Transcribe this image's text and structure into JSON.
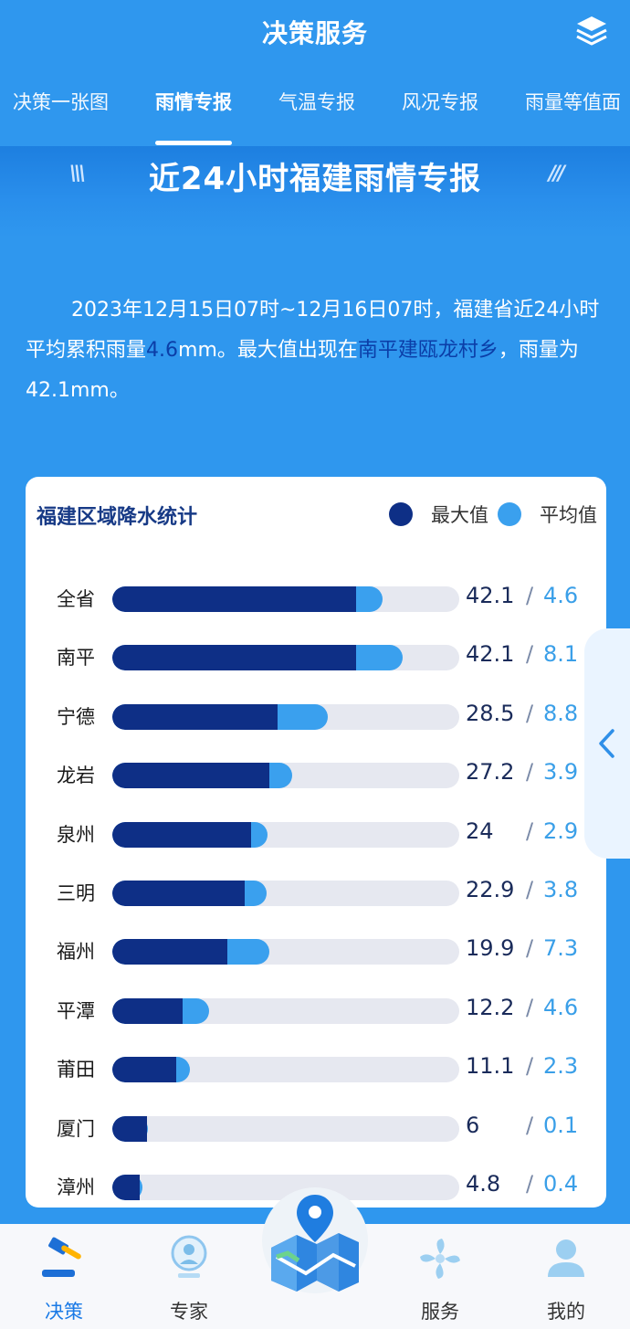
{
  "header": {
    "title": "决策服务",
    "layers_icon": "layers-icon"
  },
  "tabs": [
    {
      "label": "决策一张图",
      "active": false
    },
    {
      "label": "雨情专报",
      "active": true
    },
    {
      "label": "气温专报",
      "active": false
    },
    {
      "label": "风况专报",
      "active": false
    },
    {
      "label": "雨量等值面",
      "active": false
    }
  ],
  "banner": {
    "title": "近24小时福建雨情专报",
    "left_deco": "\\\\\\",
    "right_deco": "///"
  },
  "summary": {
    "part1": "2023年12月15日07时~12月16日07时，福建省近24小时平均累积雨量",
    "avg_value": "4.6",
    "part2": "mm。最大值出现在",
    "max_location": "南平建瓯龙村乡",
    "part3": "，雨量为",
    "max_value": "42.1",
    "part4": "mm。"
  },
  "card": {
    "title": "福建区域降水统计",
    "legend": {
      "max_label": "最大值",
      "avg_label": "平均值"
    },
    "colors": {
      "max": "#0e2f86",
      "avg": "#3aa0ee",
      "track": "#e6e8f0"
    }
  },
  "chart_data": {
    "type": "bar",
    "title": "福建区域降水统计",
    "categories": [
      "全省",
      "南平",
      "宁德",
      "龙岩",
      "泉州",
      "三明",
      "福州",
      "平潭",
      "莆田",
      "厦门",
      "漳州"
    ],
    "series": [
      {
        "name": "最大值",
        "values": [
          42.1,
          42.1,
          28.5,
          27.2,
          24,
          22.9,
          19.9,
          12.2,
          11.1,
          6,
          4.8
        ]
      },
      {
        "name": "平均值",
        "values": [
          4.6,
          8.1,
          8.8,
          3.9,
          2.9,
          3.8,
          7.3,
          4.6,
          2.3,
          0.1,
          0.4
        ]
      }
    ],
    "display_max": [
      "42.1",
      "42.1",
      "28.5",
      "27.2",
      "24",
      "22.9",
      "19.9",
      "12.2",
      "11.1",
      "6",
      "4.8"
    ],
    "display_avg": [
      "4.6",
      "8.1",
      "8.8",
      "3.9",
      "2.9",
      "3.8",
      "7.3",
      "4.6",
      "2.3",
      "0.1",
      "0.4"
    ],
    "separator": "/",
    "xlim": [
      0,
      60
    ],
    "stacked": true
  },
  "side_handle": {
    "icon": "chevron-left-icon"
  },
  "bottom_nav": [
    {
      "label": "决策",
      "icon": "gavel-icon",
      "active": true
    },
    {
      "label": "专家",
      "icon": "expert-icon",
      "active": false
    },
    {
      "label": "服务",
      "icon": "fan-icon",
      "active": false
    },
    {
      "label": "我的",
      "icon": "user-icon",
      "active": false
    }
  ],
  "center_button": {
    "icon": "map-location-icon"
  }
}
